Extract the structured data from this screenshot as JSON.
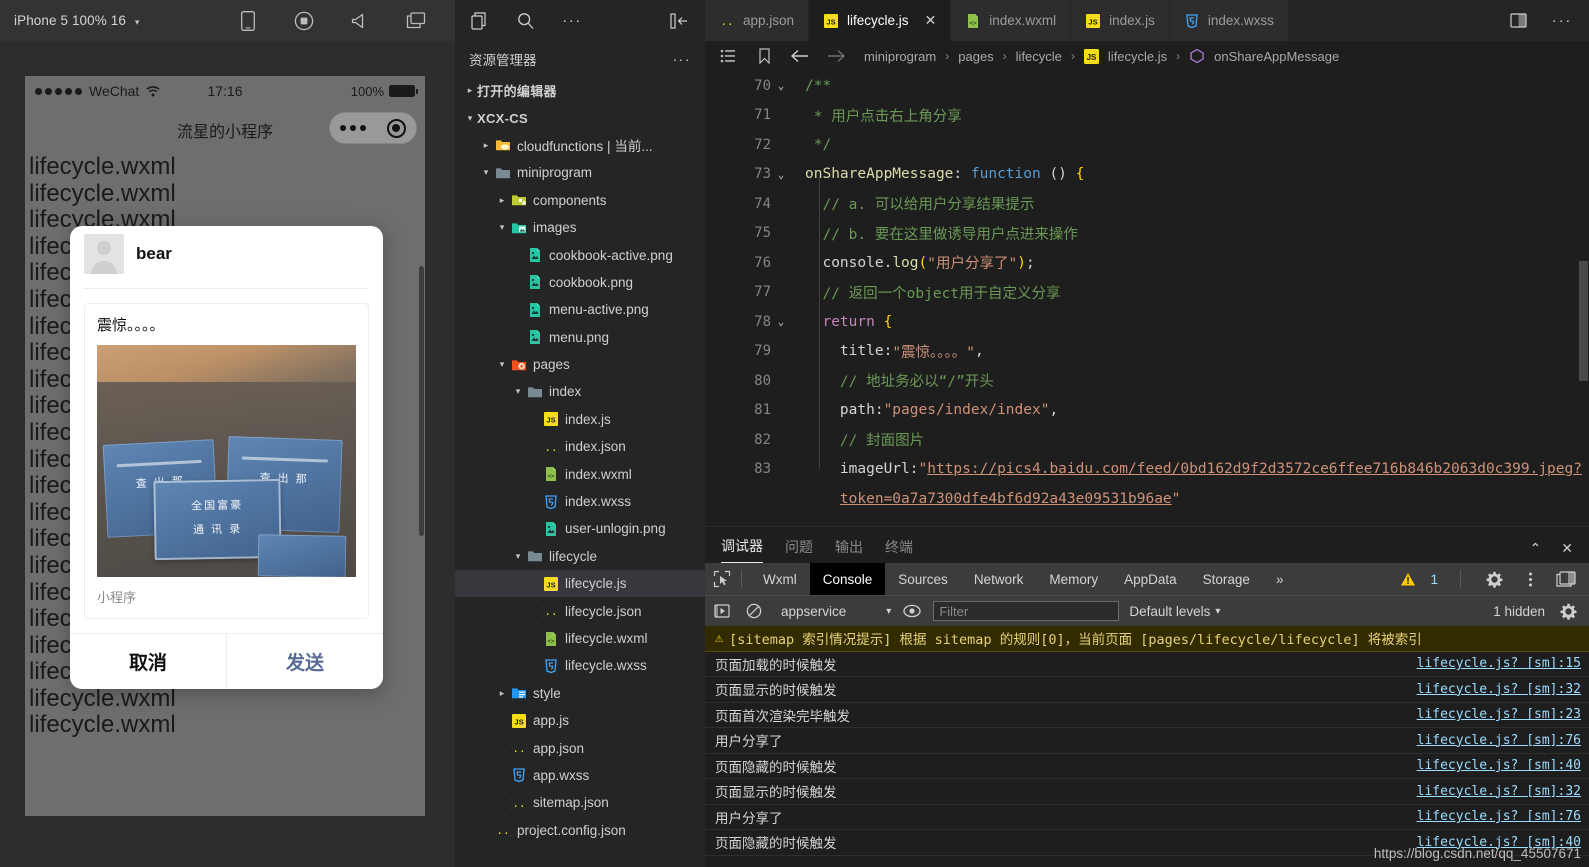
{
  "simulator": {
    "toolbar": {
      "device_label": "iPhone 5 100% 16",
      "caret": "▾",
      "icons": [
        "phone-icon",
        "record-icon",
        "volume-icon",
        "multiscreen-icon"
      ]
    },
    "phone": {
      "status_bar": {
        "carrier": "WeChat",
        "time": "17:16",
        "battery_percent": "100%"
      },
      "nav_title": "流星的小程序",
      "page_text_repeated": "lifecycle.wxml",
      "page_text_lines": 22
    },
    "share_dialog": {
      "user_name": "bear",
      "card_title": "震惊。。。。",
      "card_subtitle": "小程序",
      "cancel_label": "取消",
      "send_label": "发送"
    }
  },
  "explorer": {
    "actions": [
      "new-file-icon",
      "search-icon",
      "more-icon",
      "collapse-sidebar-icon"
    ],
    "title": "资源管理器",
    "more_dots": "···",
    "rows": [
      {
        "label": "打开的编辑器",
        "twisty": "▸",
        "indent": 0,
        "icon": "",
        "bold": true,
        "selected": false
      },
      {
        "label": "XCX-CS",
        "twisty": "▾",
        "indent": 0,
        "icon": "",
        "bold": true,
        "selected": false
      },
      {
        "label": "cloudfunctions | 当前...",
        "twisty": "▸",
        "indent": 1,
        "icon": "folder-cloud",
        "bold": false,
        "selected": false
      },
      {
        "label": "miniprogram",
        "twisty": "▾",
        "indent": 1,
        "icon": "folder",
        "bold": false,
        "selected": false
      },
      {
        "label": "components",
        "twisty": "▸",
        "indent": 2,
        "icon": "folder-components",
        "bold": false,
        "selected": false
      },
      {
        "label": "images",
        "twisty": "▾",
        "indent": 2,
        "icon": "folder-images",
        "bold": false,
        "selected": false
      },
      {
        "label": "cookbook-active.png",
        "twisty": "",
        "indent": 3,
        "icon": "png",
        "bold": false,
        "selected": false
      },
      {
        "label": "cookbook.png",
        "twisty": "",
        "indent": 3,
        "icon": "png",
        "bold": false,
        "selected": false
      },
      {
        "label": "menu-active.png",
        "twisty": "",
        "indent": 3,
        "icon": "png",
        "bold": false,
        "selected": false
      },
      {
        "label": "menu.png",
        "twisty": "",
        "indent": 3,
        "icon": "png",
        "bold": false,
        "selected": false
      },
      {
        "label": "pages",
        "twisty": "▾",
        "indent": 2,
        "icon": "folder-pages",
        "bold": false,
        "selected": false
      },
      {
        "label": "index",
        "twisty": "▾",
        "indent": 3,
        "icon": "folder",
        "bold": false,
        "selected": false
      },
      {
        "label": "index.js",
        "twisty": "",
        "indent": 4,
        "icon": "js",
        "bold": false,
        "selected": false
      },
      {
        "label": "index.json",
        "twisty": "",
        "indent": 4,
        "icon": "json",
        "bold": false,
        "selected": false
      },
      {
        "label": "index.wxml",
        "twisty": "",
        "indent": 4,
        "icon": "wxml",
        "bold": false,
        "selected": false
      },
      {
        "label": "index.wxss",
        "twisty": "",
        "indent": 4,
        "icon": "wxss",
        "bold": false,
        "selected": false
      },
      {
        "label": "user-unlogin.png",
        "twisty": "",
        "indent": 4,
        "icon": "png",
        "bold": false,
        "selected": false
      },
      {
        "label": "lifecycle",
        "twisty": "▾",
        "indent": 3,
        "icon": "folder",
        "bold": false,
        "selected": false
      },
      {
        "label": "lifecycle.js",
        "twisty": "",
        "indent": 4,
        "icon": "js",
        "bold": false,
        "selected": true
      },
      {
        "label": "lifecycle.json",
        "twisty": "",
        "indent": 4,
        "icon": "json",
        "bold": false,
        "selected": false
      },
      {
        "label": "lifecycle.wxml",
        "twisty": "",
        "indent": 4,
        "icon": "wxml",
        "bold": false,
        "selected": false
      },
      {
        "label": "lifecycle.wxss",
        "twisty": "",
        "indent": 4,
        "icon": "wxss",
        "bold": false,
        "selected": false
      },
      {
        "label": "style",
        "twisty": "▸",
        "indent": 2,
        "icon": "folder-style",
        "bold": false,
        "selected": false
      },
      {
        "label": "app.js",
        "twisty": "",
        "indent": 2,
        "icon": "js",
        "bold": false,
        "selected": false
      },
      {
        "label": "app.json",
        "twisty": "",
        "indent": 2,
        "icon": "json",
        "bold": false,
        "selected": false
      },
      {
        "label": "app.wxss",
        "twisty": "",
        "indent": 2,
        "icon": "wxss",
        "bold": false,
        "selected": false
      },
      {
        "label": "sitemap.json",
        "twisty": "",
        "indent": 2,
        "icon": "json",
        "bold": false,
        "selected": false
      },
      {
        "label": "project.config.json",
        "twisty": "",
        "indent": 1,
        "icon": "json",
        "bold": false,
        "selected": false
      }
    ]
  },
  "editor": {
    "tabs": [
      {
        "label": "app.json",
        "icon": "json",
        "active": false,
        "closable": false
      },
      {
        "label": "lifecycle.js",
        "icon": "js",
        "active": true,
        "closable": true
      },
      {
        "label": "index.wxml",
        "icon": "wxml",
        "active": false,
        "closable": false
      },
      {
        "label": "index.js",
        "icon": "js",
        "active": false,
        "closable": false
      },
      {
        "label": "index.wxss",
        "icon": "wxss",
        "active": false,
        "closable": false
      }
    ],
    "tab_close_glyph": "✕",
    "tabbar_actions": [
      "split-editor-icon",
      "more-actions-icon"
    ],
    "breadcrumb": {
      "icons": [
        "outline-icon",
        "bookmark-icon",
        "back-arrow-icon",
        "forward-arrow-icon"
      ],
      "items": [
        "miniprogram",
        "pages",
        "lifecycle",
        "lifecycle.js",
        "onShareAppMessage"
      ],
      "separator": "›"
    },
    "lines": [
      {
        "num": "70",
        "fold": "⌄",
        "segments": [
          {
            "t": "/**",
            "c": "c-com"
          }
        ]
      },
      {
        "num": "71",
        "fold": "",
        "segments": [
          {
            "t": " * 用户点击右上角分享",
            "c": "c-com"
          }
        ]
      },
      {
        "num": "72",
        "fold": "",
        "segments": [
          {
            "t": " */",
            "c": "c-com"
          }
        ]
      },
      {
        "num": "73",
        "fold": "⌄",
        "segments": [
          {
            "t": "onShareAppMessage",
            "c": "c-fn"
          },
          {
            "t": ": ",
            "c": "c-pun"
          },
          {
            "t": "function",
            "c": "c-kw"
          },
          {
            "t": " () ",
            "c": "c-pun"
          },
          {
            "t": "{",
            "c": "c-yel"
          }
        ]
      },
      {
        "num": "74",
        "fold": "",
        "segments": [
          {
            "t": "  // a. 可以给用户分享结果提示",
            "c": "c-com"
          }
        ]
      },
      {
        "num": "75",
        "fold": "",
        "segments": [
          {
            "t": "  // b. 要在这里做诱导用户点进来操作",
            "c": "c-com"
          }
        ]
      },
      {
        "num": "76",
        "fold": "",
        "segments": [
          {
            "t": "  console",
            "c": "c-pun"
          },
          {
            "t": ".",
            "c": "c-pun"
          },
          {
            "t": "log",
            "c": "c-fn"
          },
          {
            "t": "(",
            "c": "c-yel"
          },
          {
            "t": "\"用户分享了\"",
            "c": "c-str"
          },
          {
            "t": ")",
            "c": "c-yel"
          },
          {
            "t": ";",
            "c": "c-pun"
          }
        ]
      },
      {
        "num": "77",
        "fold": "",
        "segments": [
          {
            "t": "  // 返回一个object用于自定义分享",
            "c": "c-com"
          }
        ]
      },
      {
        "num": "78",
        "fold": "⌄",
        "segments": [
          {
            "t": "  ",
            "c": "c-pun"
          },
          {
            "t": "return",
            "c": "c-pink"
          },
          {
            "t": " ",
            "c": "c-pun"
          },
          {
            "t": "{",
            "c": "c-yel"
          }
        ]
      },
      {
        "num": "79",
        "fold": "",
        "segments": [
          {
            "t": "    title:",
            "c": "c-pun"
          },
          {
            "t": "\"震惊。。。。\"",
            "c": "c-str"
          },
          {
            "t": ",",
            "c": "c-pun"
          }
        ]
      },
      {
        "num": "80",
        "fold": "",
        "segments": [
          {
            "t": "    // 地址务必以“/”开头",
            "c": "c-com"
          }
        ]
      },
      {
        "num": "81",
        "fold": "",
        "segments": [
          {
            "t": "    path:",
            "c": "c-pun"
          },
          {
            "t": "\"pages/index/index\"",
            "c": "c-str"
          },
          {
            "t": ",",
            "c": "c-pun"
          }
        ]
      },
      {
        "num": "82",
        "fold": "",
        "segments": [
          {
            "t": "    // 封面图片",
            "c": "c-com"
          }
        ]
      },
      {
        "num": "83",
        "fold": "",
        "segments": [
          {
            "t": "    imageUrl:",
            "c": "c-pun"
          },
          {
            "t": "\"",
            "c": "c-str"
          },
          {
            "t": "https://pics4.baidu.com/feed/0bd162d9f2d3572ce6ffee716b846b2063d0c399.jpeg?",
            "c": "c-link"
          }
        ]
      },
      {
        "num": "",
        "fold": "",
        "segments": [
          {
            "t": "    ",
            "c": "c-pun"
          },
          {
            "t": "token=0a7a7300dfe4bf6d92a43e09531b96ae",
            "c": "c-link"
          },
          {
            "t": "\"",
            "c": "c-str"
          }
        ]
      }
    ]
  },
  "panel": {
    "tabs": [
      {
        "label": "调试器",
        "active": true
      },
      {
        "label": "问题",
        "active": false
      },
      {
        "label": "输出",
        "active": false
      },
      {
        "label": "终端",
        "active": false
      }
    ],
    "actions": {
      "collapse": "⌃",
      "close": "✕"
    },
    "devtools": {
      "inspect_icon": "inspect-element-icon",
      "tabs": [
        {
          "label": "Wxml",
          "active": false
        },
        {
          "label": "Console",
          "active": true
        },
        {
          "label": "Sources",
          "active": false
        },
        {
          "label": "Network",
          "active": false
        },
        {
          "label": "Memory",
          "active": false
        },
        {
          "label": "AppData",
          "active": false
        },
        {
          "label": "Storage",
          "active": false
        }
      ],
      "overflow": "»",
      "warning_count": "1",
      "right_icons": [
        "settings-gear-icon",
        "kebab-menu-icon",
        "dock-icon"
      ]
    },
    "filterbar": {
      "execute_icon": "execute-icon",
      "clear_icon": "clear-console-icon",
      "context": "appservice",
      "context_caret": "▾",
      "eye_icon": "live-expression-icon",
      "filter_placeholder": "Filter",
      "filter_value": "",
      "levels_label": "Default levels",
      "levels_caret": "▾",
      "hidden_label": "1 hidden",
      "settings_icon": "settings-gear-icon"
    },
    "console_rows": [
      {
        "warning": true,
        "text": "[sitemap 索引情况提示] 根据 sitemap 的规则[0]，当前页面 [pages/lifecycle/lifecycle] 将被索引",
        "source": ""
      },
      {
        "warning": false,
        "text": "页面加载的时候触发",
        "source": "lifecycle.js? [sm]:15"
      },
      {
        "warning": false,
        "text": "页面显示的时候触发",
        "source": "lifecycle.js? [sm]:32"
      },
      {
        "warning": false,
        "text": "页面首次渲染完毕触发",
        "source": "lifecycle.js? [sm]:23"
      },
      {
        "warning": false,
        "text": "用户分享了",
        "source": "lifecycle.js? [sm]:76"
      },
      {
        "warning": false,
        "text": "页面隐藏的时候触发",
        "source": "lifecycle.js? [sm]:40"
      },
      {
        "warning": false,
        "text": "页面显示的时候触发",
        "source": "lifecycle.js? [sm]:32"
      },
      {
        "warning": false,
        "text": "用户分享了",
        "source": "lifecycle.js? [sm]:76"
      },
      {
        "warning": false,
        "text": "页面隐藏的时候触发",
        "source": "lifecycle.js? [sm]:40"
      }
    ],
    "status_overlay": "https://blog.csdn.net/qq_45507671"
  },
  "colors": {
    "accent": "#0e639c",
    "editor_bg": "#1e1e1e",
    "sidebar_bg": "#252526",
    "tab_active_bg": "#1e1e1e",
    "warning": "#ffcc00",
    "link": "#9cdcfe",
    "send_button": "#576b95"
  }
}
